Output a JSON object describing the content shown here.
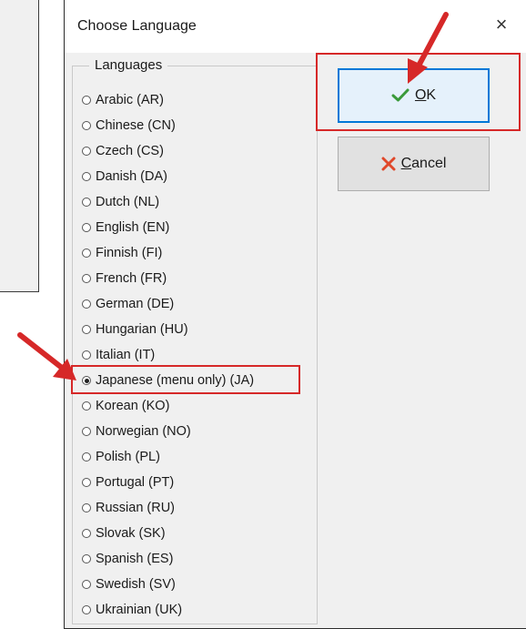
{
  "dialog": {
    "title": "Choose Language",
    "close_label": "×"
  },
  "languages": {
    "group_label": "Languages",
    "items": [
      {
        "label": "Arabic (AR)",
        "checked": false
      },
      {
        "label": "Chinese (CN)",
        "checked": false
      },
      {
        "label": "Czech (CS)",
        "checked": false
      },
      {
        "label": "Danish (DA)",
        "checked": false
      },
      {
        "label": "Dutch (NL)",
        "checked": false
      },
      {
        "label": "English (EN)",
        "checked": false
      },
      {
        "label": "Finnish (FI)",
        "checked": false
      },
      {
        "label": "French (FR)",
        "checked": false
      },
      {
        "label": "German (DE)",
        "checked": false
      },
      {
        "label": "Hungarian (HU)",
        "checked": false
      },
      {
        "label": "Italian (IT)",
        "checked": false
      },
      {
        "label": "Japanese (menu only) (JA)",
        "checked": true
      },
      {
        "label": "Korean (KO)",
        "checked": false
      },
      {
        "label": "Norwegian (NO)",
        "checked": false
      },
      {
        "label": "Polish (PL)",
        "checked": false
      },
      {
        "label": "Portugal (PT)",
        "checked": false
      },
      {
        "label": "Russian (RU)",
        "checked": false
      },
      {
        "label": "Slovak (SK)",
        "checked": false
      },
      {
        "label": "Spanish (ES)",
        "checked": false
      },
      {
        "label": "Swedish (SV)",
        "checked": false
      },
      {
        "label": "Ukrainian (UK)",
        "checked": false
      }
    ]
  },
  "buttons": {
    "ok": {
      "accel": "O",
      "rest": "K",
      "icon": "checkmark-icon"
    },
    "cancel": {
      "accel": "C",
      "rest": "ancel",
      "icon": "x-icon"
    }
  },
  "colors": {
    "annotation_red": "#d62828",
    "ok_check": "#3a9a3a",
    "cancel_x": "#e0482a",
    "focus_blue": "#0078d7"
  }
}
